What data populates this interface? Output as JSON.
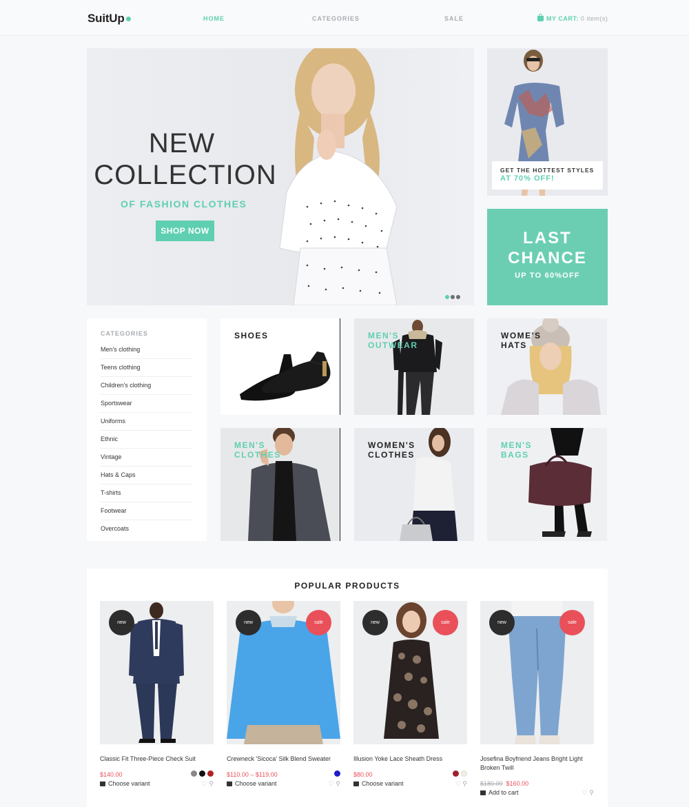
{
  "brand": {
    "name": "SuitUp"
  },
  "nav": {
    "home": "HOME",
    "categories": "CATEGORIES",
    "sale": "SALE"
  },
  "cart": {
    "label": "MY CART:",
    "count": "0 item(s)"
  },
  "hero": {
    "line1": "NEW",
    "line2": "COLLECTION",
    "subtitle": "OF FASHION CLOTHES",
    "button": "SHOP NOW",
    "slides": 3,
    "active_slide": 1
  },
  "promo": {
    "line1": "GET THE HOTTEST STYLES",
    "line2": "AT 70% OFF!"
  },
  "last_chance": {
    "line1": "LAST",
    "line2": "CHANCE",
    "line3": "UP TO 60%OFF"
  },
  "sidebar": {
    "title": "CATEGORIES",
    "items": [
      "Men's clothing",
      "Teens clothing",
      "Children's clothing",
      "Sportswear",
      "Uniforms",
      "Ethnic",
      "Vintage",
      "Hats & Caps",
      "T-shirts",
      "Footwear",
      "Overcoats"
    ]
  },
  "tiles": [
    {
      "line1": "SHOES",
      "line2": ""
    },
    {
      "line1": "MEN'S",
      "line2": "OUTWEAR"
    },
    {
      "line1": "WOME'S",
      "line2": "HATS"
    },
    {
      "line1": "MEN'S",
      "line2": "CLOTHES"
    },
    {
      "line1": "WOMEN'S",
      "line2": "CLOTHES"
    },
    {
      "line1": "MEN'S",
      "line2": "BAGS"
    }
  ],
  "popular": {
    "title": "POPULAR PRODUCTS",
    "products": [
      {
        "name": "Classic Fit Three-Piece Check Suit",
        "price": "$140.00",
        "old_price": "",
        "action": "Choose variant",
        "badge_new": "new",
        "badge_sale": "",
        "swatches": [
          "#888888",
          "#111111",
          "#b22222"
        ]
      },
      {
        "name": "Crewneck 'Sicoca' Silk Blend Sweater",
        "price": "$110.00 – $119.00",
        "old_price": "",
        "action": "Choose variant",
        "badge_new": "new",
        "badge_sale": "sale",
        "swatches": [
          "#1f1fc9"
        ]
      },
      {
        "name": "Illusion Yoke Lace Sheath Dress",
        "price": "$80.00",
        "old_price": "",
        "action": "Choose variant",
        "badge_new": "new",
        "badge_sale": "sale",
        "swatches": [
          "#a0202a",
          "#f3efe0"
        ]
      },
      {
        "name": "Josefina Boyfriend Jeans Bright Light Broken Twill",
        "price": "$160.00",
        "old_price": "$180.00",
        "action": "Add to cart",
        "badge_new": "new",
        "badge_sale": "sale",
        "swatches": []
      }
    ]
  },
  "colors": {
    "accent": "#5ecfb0",
    "sale": "#e9505a",
    "dark": "#2d2d2d"
  },
  "icons": [
    "cart-icon",
    "heart-icon",
    "zoom-icon"
  ]
}
